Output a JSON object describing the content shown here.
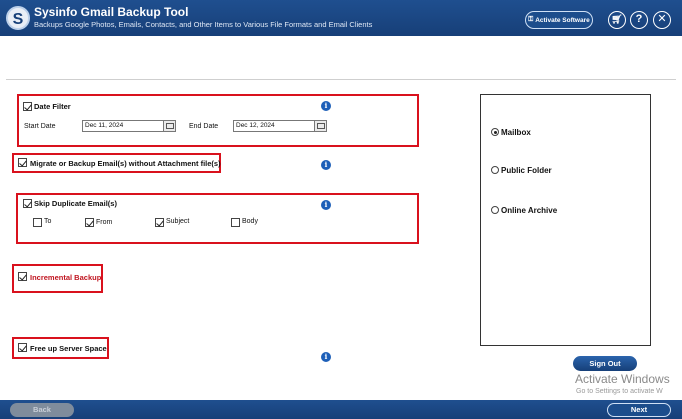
{
  "header": {
    "title": "Sysinfo Gmail Backup Tool",
    "subtitle": "Backups Google Photos, Emails, Contacts, and Other Items to Various File Formats and Email Clients",
    "logo_letter": "S",
    "activate_label": "Activate Software",
    "help_glyph": "?",
    "close_glyph": "✕"
  },
  "filters": {
    "date_filter": {
      "label": "Date Filter",
      "checked": true
    },
    "start_label": "Start Date",
    "start_value": "Dec 11, 2024",
    "end_label": "End Date",
    "end_value": "Dec 12, 2024",
    "migrate_label": "Migrate or Backup Email(s) without Attachment file(s)",
    "skip_duplicate_label": "Skip Duplicate Email(s)",
    "dup_fields": [
      {
        "label": "To",
        "checked": false
      },
      {
        "label": "From",
        "checked": true
      },
      {
        "label": "Subject",
        "checked": true
      },
      {
        "label": "Body",
        "checked": false
      }
    ],
    "incremental_label": "Incremental Backup",
    "free_space_label": "Free up Server Space"
  },
  "targets": {
    "options": [
      {
        "label": "Mailbox",
        "selected": true
      },
      {
        "label": "Public Folder",
        "selected": false
      },
      {
        "label": "Online Archive",
        "selected": false
      }
    ]
  },
  "actions": {
    "sign_out": "Sign Out",
    "back": "Back",
    "next": "Next"
  },
  "watermark": {
    "line1": "Activate Windows",
    "line2": "Go to Settings to activate W"
  },
  "colors": {
    "brand": "#173f78",
    "highlight": "#d9111d",
    "info": "#1d5fb8"
  }
}
